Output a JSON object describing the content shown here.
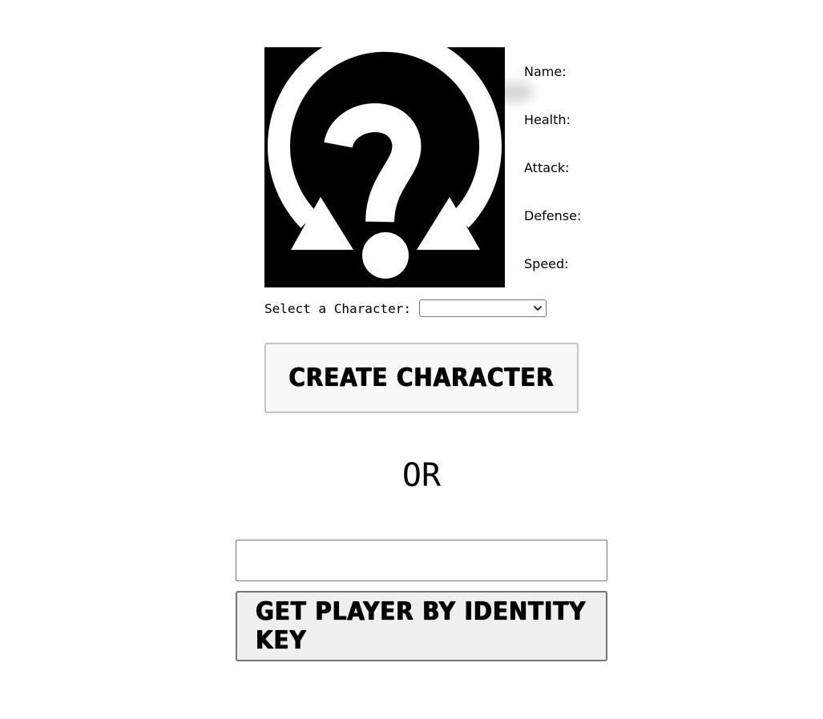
{
  "character": {
    "portrait_icon": "question-mark-refresh-icon",
    "stats": {
      "name_label": "Name:",
      "health_label": "Health:",
      "attack_label": "Attack:",
      "defense_label": "Defense:",
      "speed_label": "Speed:"
    }
  },
  "selector": {
    "label": "Select a Character:",
    "selected_value": ""
  },
  "buttons": {
    "create_label": "Create Character",
    "get_player_label": "Get Player by Identity Key"
  },
  "divider": {
    "or_text": "OR"
  },
  "identity_key": {
    "value": "",
    "placeholder": ""
  }
}
